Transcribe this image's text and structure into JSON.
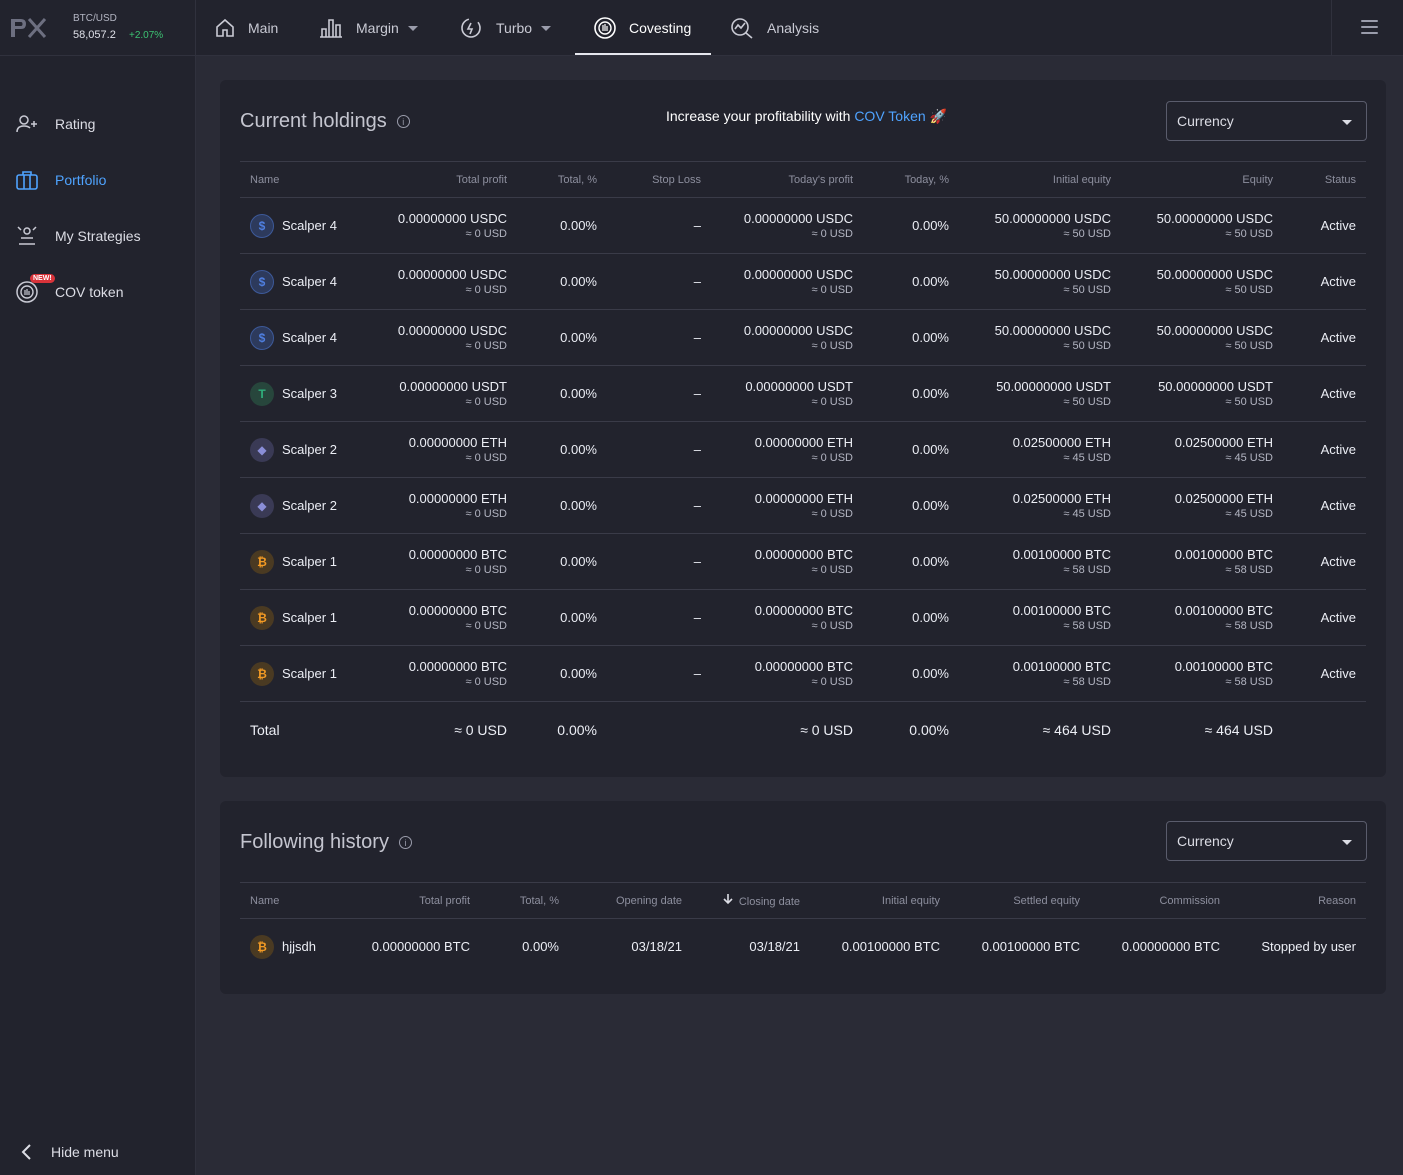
{
  "topbar": {
    "pair": "BTC/USD",
    "price": "58,057.2",
    "change": "+2.07%",
    "nav": [
      {
        "label": "Main",
        "icon": "home-icon"
      },
      {
        "label": "Margin",
        "icon": "bar-chart-icon"
      },
      {
        "label": "Turbo",
        "icon": "turbo-icon"
      },
      {
        "label": "Covesting",
        "icon": "covesting-icon"
      },
      {
        "label": "Analysis",
        "icon": "analysis-icon"
      }
    ],
    "active_tab": "Covesting"
  },
  "sidebar": {
    "items": [
      {
        "label": "Rating",
        "icon": "user-star-icon"
      },
      {
        "label": "Portfolio",
        "icon": "portfolio-icon"
      },
      {
        "label": "My Strategies",
        "icon": "strategies-icon"
      },
      {
        "label": "COV token",
        "icon": "cov-token-icon",
        "badge": "NEW!"
      }
    ],
    "active": "Portfolio",
    "hide_menu": "Hide menu"
  },
  "holdings": {
    "title": "Current holdings",
    "promo_prefix": "Increase your profitability with",
    "promo_link": "COV Token",
    "promo_emoji": "🚀",
    "currency_select": "Currency",
    "columns": [
      "Name",
      "Total profit",
      "Total, %",
      "Stop Loss",
      "Today's profit",
      "Today, %",
      "Initial equity",
      "Equity",
      "Status"
    ],
    "rows": [
      {
        "coin": "usdc",
        "name": "Scalper 4",
        "total_profit": "0.00000000 USDC",
        "total_profit_usd": "≈ 0 USD",
        "total_pct": "0.00%",
        "stop_loss": "–",
        "today_profit": "0.00000000 USDC",
        "today_profit_usd": "≈ 0 USD",
        "today_pct": "0.00%",
        "initial_equity": "50.00000000 USDC",
        "initial_equity_usd": "≈ 50 USD",
        "equity": "50.00000000 USDC",
        "equity_usd": "≈ 50 USD",
        "status": "Active"
      },
      {
        "coin": "usdc",
        "name": "Scalper 4",
        "total_profit": "0.00000000 USDC",
        "total_profit_usd": "≈ 0 USD",
        "total_pct": "0.00%",
        "stop_loss": "–",
        "today_profit": "0.00000000 USDC",
        "today_profit_usd": "≈ 0 USD",
        "today_pct": "0.00%",
        "initial_equity": "50.00000000 USDC",
        "initial_equity_usd": "≈ 50 USD",
        "equity": "50.00000000 USDC",
        "equity_usd": "≈ 50 USD",
        "status": "Active"
      },
      {
        "coin": "usdc",
        "name": "Scalper 4",
        "total_profit": "0.00000000 USDC",
        "total_profit_usd": "≈ 0 USD",
        "total_pct": "0.00%",
        "stop_loss": "–",
        "today_profit": "0.00000000 USDC",
        "today_profit_usd": "≈ 0 USD",
        "today_pct": "0.00%",
        "initial_equity": "50.00000000 USDC",
        "initial_equity_usd": "≈ 50 USD",
        "equity": "50.00000000 USDC",
        "equity_usd": "≈ 50 USD",
        "status": "Active"
      },
      {
        "coin": "usdt",
        "name": "Scalper 3",
        "total_profit": "0.00000000 USDT",
        "total_profit_usd": "≈ 0 USD",
        "total_pct": "0.00%",
        "stop_loss": "–",
        "today_profit": "0.00000000 USDT",
        "today_profit_usd": "≈ 0 USD",
        "today_pct": "0.00%",
        "initial_equity": "50.00000000 USDT",
        "initial_equity_usd": "≈ 50 USD",
        "equity": "50.00000000 USDT",
        "equity_usd": "≈ 50 USD",
        "status": "Active"
      },
      {
        "coin": "eth",
        "name": "Scalper 2",
        "total_profit": "0.00000000 ETH",
        "total_profit_usd": "≈ 0 USD",
        "total_pct": "0.00%",
        "stop_loss": "–",
        "today_profit": "0.00000000 ETH",
        "today_profit_usd": "≈ 0 USD",
        "today_pct": "0.00%",
        "initial_equity": "0.02500000 ETH",
        "initial_equity_usd": "≈ 45 USD",
        "equity": "0.02500000 ETH",
        "equity_usd": "≈ 45 USD",
        "status": "Active"
      },
      {
        "coin": "eth",
        "name": "Scalper 2",
        "total_profit": "0.00000000 ETH",
        "total_profit_usd": "≈ 0 USD",
        "total_pct": "0.00%",
        "stop_loss": "–",
        "today_profit": "0.00000000 ETH",
        "today_profit_usd": "≈ 0 USD",
        "today_pct": "0.00%",
        "initial_equity": "0.02500000 ETH",
        "initial_equity_usd": "≈ 45 USD",
        "equity": "0.02500000 ETH",
        "equity_usd": "≈ 45 USD",
        "status": "Active"
      },
      {
        "coin": "btc",
        "name": "Scalper 1",
        "total_profit": "0.00000000 BTC",
        "total_profit_usd": "≈ 0 USD",
        "total_pct": "0.00%",
        "stop_loss": "–",
        "today_profit": "0.00000000 BTC",
        "today_profit_usd": "≈ 0 USD",
        "today_pct": "0.00%",
        "initial_equity": "0.00100000 BTC",
        "initial_equity_usd": "≈ 58 USD",
        "equity": "0.00100000 BTC",
        "equity_usd": "≈ 58 USD",
        "status": "Active"
      },
      {
        "coin": "btc",
        "name": "Scalper 1",
        "total_profit": "0.00000000 BTC",
        "total_profit_usd": "≈ 0 USD",
        "total_pct": "0.00%",
        "stop_loss": "–",
        "today_profit": "0.00000000 BTC",
        "today_profit_usd": "≈ 0 USD",
        "today_pct": "0.00%",
        "initial_equity": "0.00100000 BTC",
        "initial_equity_usd": "≈ 58 USD",
        "equity": "0.00100000 BTC",
        "equity_usd": "≈ 58 USD",
        "status": "Active"
      },
      {
        "coin": "btc",
        "name": "Scalper 1",
        "total_profit": "0.00000000 BTC",
        "total_profit_usd": "≈ 0 USD",
        "total_pct": "0.00%",
        "stop_loss": "–",
        "today_profit": "0.00000000 BTC",
        "today_profit_usd": "≈ 0 USD",
        "today_pct": "0.00%",
        "initial_equity": "0.00100000 BTC",
        "initial_equity_usd": "≈ 58 USD",
        "equity": "0.00100000 BTC",
        "equity_usd": "≈ 58 USD",
        "status": "Active"
      }
    ],
    "total": {
      "label": "Total",
      "total_profit": "≈ 0 USD",
      "total_pct": "0.00%",
      "today_profit": "≈ 0 USD",
      "today_pct": "0.00%",
      "initial_equity": "≈ 464 USD",
      "equity": "≈ 464 USD"
    }
  },
  "history": {
    "title": "Following history",
    "currency_select": "Currency",
    "columns": [
      "Name",
      "Total profit",
      "Total, %",
      "Opening date",
      "Closing date",
      "Initial equity",
      "Settled equity",
      "Commission",
      "Reason"
    ],
    "rows": [
      {
        "coin": "btc",
        "name": "hjjsdh",
        "total_profit": "0.00000000 BTC",
        "total_pct": "0.00%",
        "opening_date": "03/18/21",
        "closing_date": "03/18/21",
        "initial_equity": "0.00100000 BTC",
        "settled_equity": "0.00100000 BTC",
        "commission": "0.00000000 BTC",
        "reason": "Stopped by user"
      }
    ]
  },
  "colors": {
    "accent": "#4fa3ff",
    "positive": "#3cc272",
    "badge": "#d9333a",
    "background": "#2a2b36",
    "panel": "#22232d"
  }
}
